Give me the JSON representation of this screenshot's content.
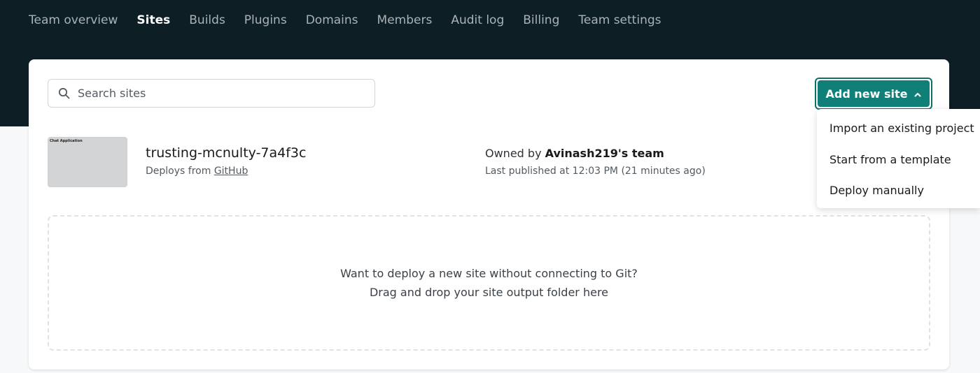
{
  "nav": {
    "items": [
      {
        "label": "Team overview",
        "active": false
      },
      {
        "label": "Sites",
        "active": true
      },
      {
        "label": "Builds",
        "active": false
      },
      {
        "label": "Plugins",
        "active": false
      },
      {
        "label": "Domains",
        "active": false
      },
      {
        "label": "Members",
        "active": false
      },
      {
        "label": "Audit log",
        "active": false
      },
      {
        "label": "Billing",
        "active": false
      },
      {
        "label": "Team settings",
        "active": false
      }
    ]
  },
  "search": {
    "placeholder": "Search sites",
    "value": "",
    "icon": "search-icon"
  },
  "add_site": {
    "label": "Add new site",
    "icon": "chevron-up-icon"
  },
  "dropdown": {
    "items": [
      "Import an existing project",
      "Start from a template",
      "Deploy manually"
    ]
  },
  "site": {
    "thumbnail_title": "Chat Application",
    "name": "trusting-mcnulty-7a4f3c",
    "deploys_prefix": "Deploys from",
    "deploys_source": "GitHub",
    "owned_prefix": "Owned by",
    "owner": "Avinash219's team",
    "published": "Last published at 12:03 PM (21 minutes ago)"
  },
  "dropzone": {
    "line1": "Want to deploy a new site without connecting to Git?",
    "line2": "Drag and drop your site output folder here"
  },
  "colors": {
    "header_bg": "#0e1e25",
    "accent": "#0f7f78",
    "page_bg": "#f6f8f9"
  }
}
